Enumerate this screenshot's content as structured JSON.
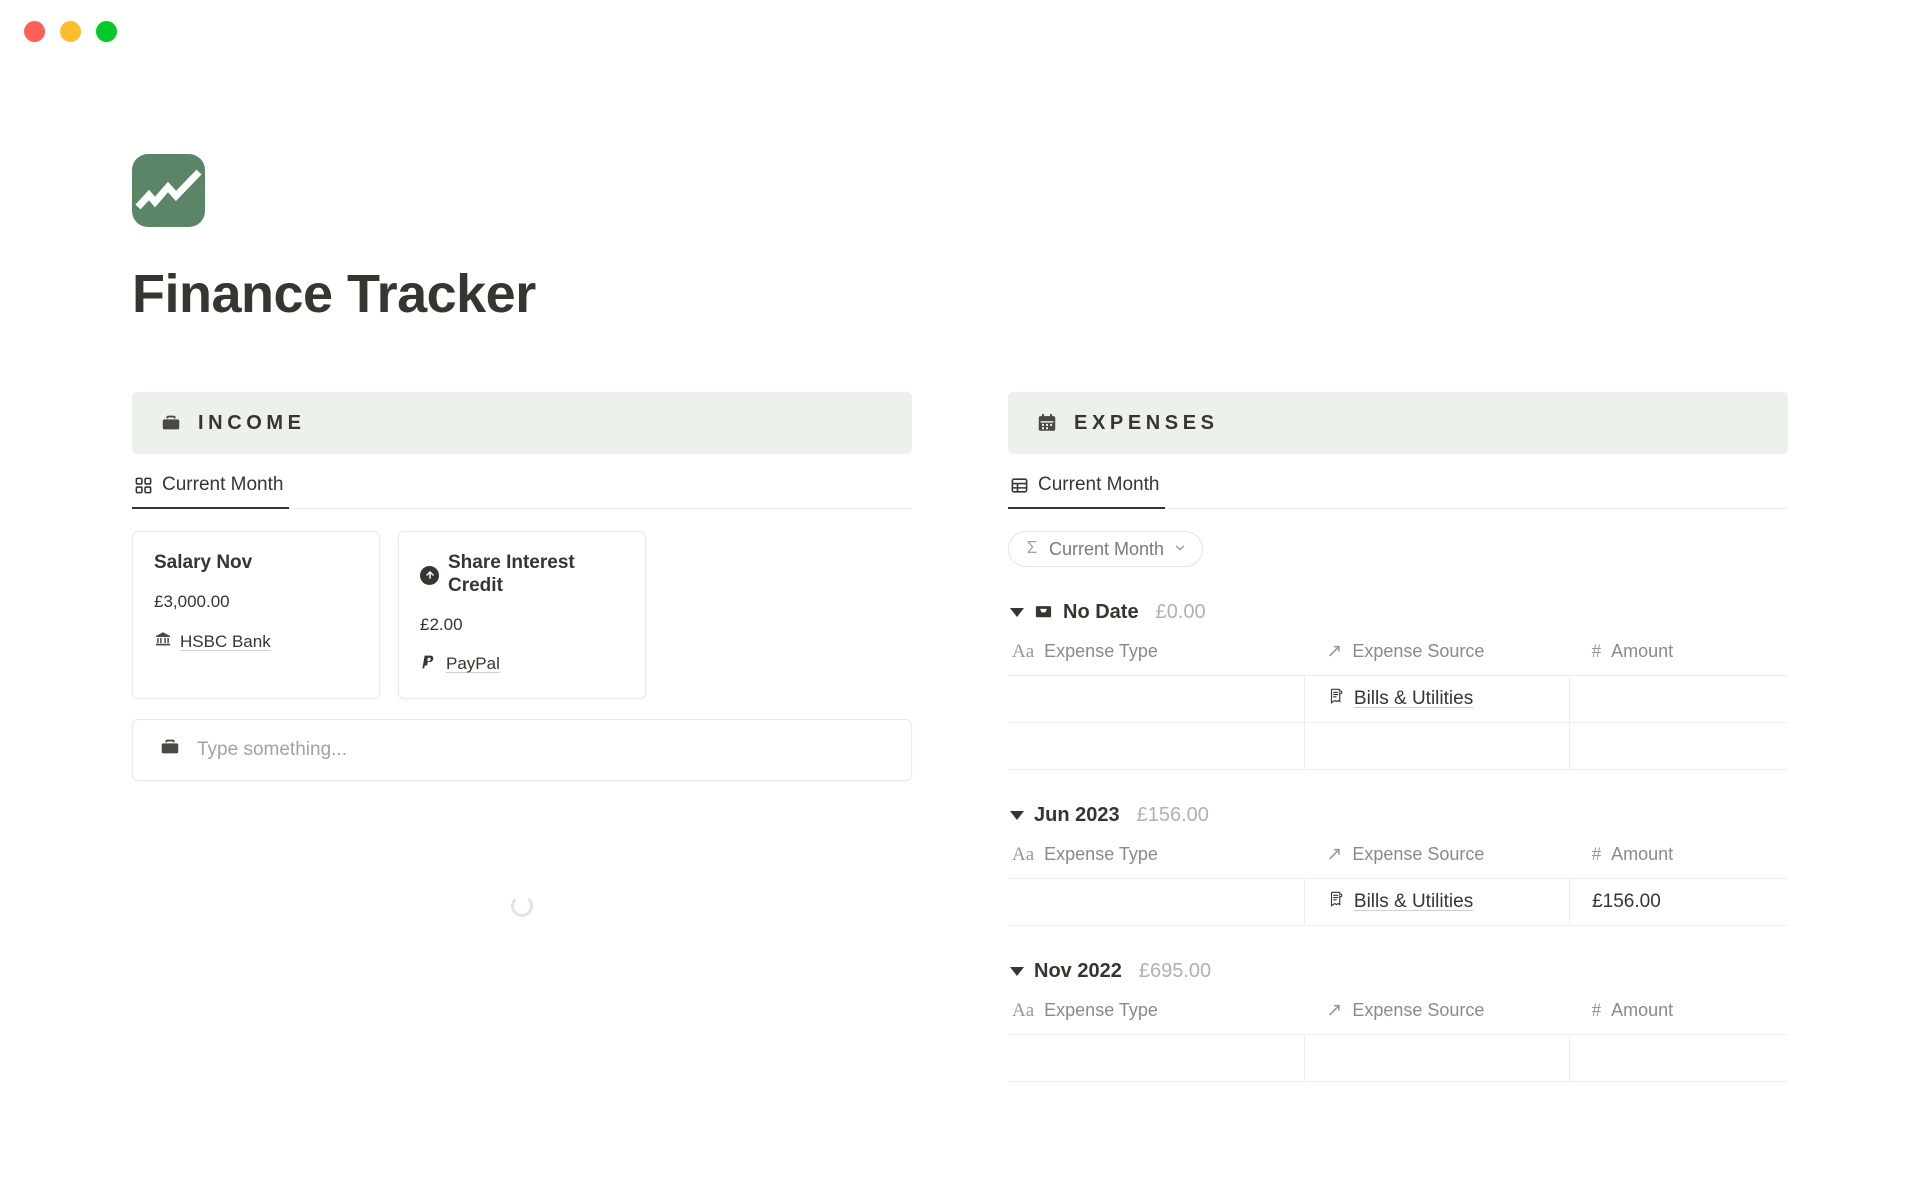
{
  "window": {
    "close_label": "close",
    "minimize_label": "minimize",
    "maximize_label": "maximize"
  },
  "page": {
    "title": "Finance Tracker",
    "logo_color": "#5a8566",
    "title_color": "#37352f",
    "banner_color": "#ecf1ec"
  },
  "income": {
    "section_title": "INCOME",
    "section_icon": "briefcase-icon",
    "tabs": [
      {
        "label": "Current Month",
        "icon": "gallery-view-icon",
        "active": true
      }
    ],
    "cards": [
      {
        "name": "Salary Nov",
        "icon": null,
        "amount": "£3,000.00",
        "source": "HSBC Bank",
        "source_icon": "bank-icon"
      },
      {
        "name": "Share Interest Credit",
        "icon": "arrow-up-circle-icon",
        "amount": "£2.00",
        "source": "PayPal",
        "source_icon": "paypal-icon"
      }
    ],
    "input": {
      "placeholder": "Type something...",
      "value": "",
      "icon": "briefcase-icon"
    },
    "loading": true
  },
  "expenses": {
    "section_title": "EXPENSES",
    "section_icon": "calendar-icon",
    "tabs": [
      {
        "label": "Current Month",
        "icon": "table-view-icon",
        "active": true
      }
    ],
    "filter_chip": {
      "label": "Current Month",
      "icon": "sigma-icon",
      "chevron": "chevron-down-icon"
    },
    "columns": [
      {
        "label": "Expense Type",
        "icon": "Aa"
      },
      {
        "label": "Expense Source",
        "icon": "↗"
      },
      {
        "label": "Amount",
        "icon": "#"
      }
    ],
    "groups": [
      {
        "name": "No Date",
        "icon": "inbox-icon",
        "total": "£0.00",
        "expanded": true,
        "rows": [
          {
            "type": "",
            "source": "Bills & Utilities",
            "source_icon": "receipt-icon",
            "amount": ""
          },
          {
            "type": "",
            "source": "",
            "source_icon": null,
            "amount": ""
          }
        ]
      },
      {
        "name": "Jun 2023",
        "icon": null,
        "total": "£156.00",
        "expanded": true,
        "rows": [
          {
            "type": "",
            "source": "Bills & Utilities",
            "source_icon": "receipt-icon",
            "amount": "£156.00"
          }
        ]
      },
      {
        "name": "Nov 2022",
        "icon": null,
        "total": "£695.00",
        "expanded": true,
        "rows": [
          {
            "type": "",
            "source": "",
            "source_icon": null,
            "amount": ""
          }
        ]
      }
    ]
  }
}
